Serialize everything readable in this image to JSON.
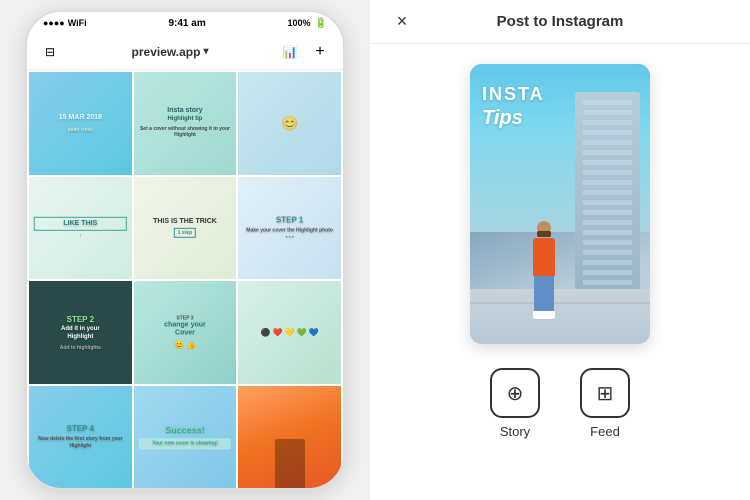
{
  "left": {
    "status_bar": {
      "time": "9:41 am",
      "battery": "100%",
      "signal": "●●●●"
    },
    "nav": {
      "icon_left": "⊟",
      "title": "preview.app",
      "dropdown_arrow": "▾",
      "icon_chart": "📊",
      "icon_plus": "+"
    },
    "grid_cells": [
      {
        "id": 1,
        "class": "cell-1",
        "text": "15 MAR 2018",
        "text_color": "white"
      },
      {
        "id": 2,
        "class": "cell-2",
        "text": "Insta story Highlight tip",
        "text_color": "dark"
      },
      {
        "id": 3,
        "class": "cell-3",
        "text": "",
        "text_color": "white"
      },
      {
        "id": 4,
        "class": "cell-4",
        "text": "LIKE THIS",
        "text_color": "teal"
      },
      {
        "id": 5,
        "class": "cell-5",
        "text": "THIS IS THE TRICK",
        "text_color": "dark"
      },
      {
        "id": 6,
        "class": "cell-6",
        "text": "STEP 1",
        "text_color": "teal"
      },
      {
        "id": 7,
        "class": "cell-7",
        "text": "STEP 2\nAdd it in your Highlight",
        "text_color": "white"
      },
      {
        "id": 8,
        "class": "cell-8",
        "text": "change your Cover",
        "text_color": "dark"
      },
      {
        "id": 9,
        "class": "cell-9",
        "text": "",
        "text_color": "white"
      },
      {
        "id": 10,
        "class": "cell-10",
        "text": "STEP 4",
        "text_color": "teal"
      },
      {
        "id": 11,
        "class": "cell-11",
        "text": "Success!",
        "text_color": "teal"
      },
      {
        "id": 12,
        "class": "cell-12",
        "text": "",
        "text_color": "white"
      }
    ]
  },
  "right": {
    "header": {
      "close_label": "×",
      "title": "Post to Instagram"
    },
    "story_text": {
      "line1": "INSTA",
      "line2": "Tips"
    },
    "actions": [
      {
        "id": "story",
        "icon": "⊕",
        "label": "Story"
      },
      {
        "id": "feed",
        "icon": "⊞",
        "label": "Feed"
      }
    ]
  }
}
